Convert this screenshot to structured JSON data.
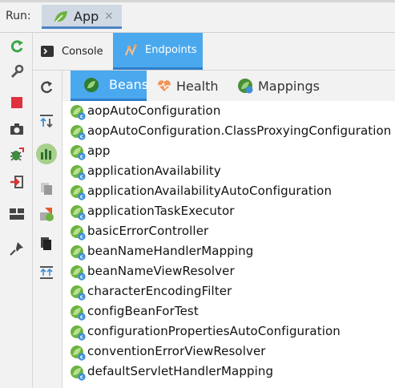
{
  "run": {
    "label": "Run:",
    "tab_label": "App",
    "tab_close": "×"
  },
  "toolbar": {
    "left_icons": [
      "rerun-icon",
      "wrench-icon",
      "stop-icon",
      "camera-icon",
      "debug-bug-icon",
      "exit-icon",
      "layout-icon",
      "pin-icon"
    ]
  },
  "subtabs": [
    {
      "label": "Console",
      "icon": "console-icon",
      "selected": false
    },
    {
      "label": "Endpoints",
      "icon": "endpoints-icon",
      "selected": true
    }
  ],
  "side_icons": [
    "refresh-icon",
    "sort-icon",
    "chart-icon",
    "copy-files-icon",
    "beans-graph-icon",
    "pages-icon",
    "expand-icon"
  ],
  "bean_tabs": [
    {
      "label": "Beans",
      "selected": true
    },
    {
      "label": "Health",
      "selected": false
    },
    {
      "label": "Mappings",
      "selected": false
    }
  ],
  "beans": [
    "aopAutoConfiguration",
    "aopAutoConfiguration.ClassProxyingConfiguration",
    "app",
    "applicationAvailability",
    "applicationAvailabilityAutoConfiguration",
    "applicationTaskExecutor",
    "basicErrorController",
    "beanNameHandlerMapping",
    "beanNameViewResolver",
    "characterEncodingFilter",
    "configBeanForTest",
    "configurationPropertiesAutoConfiguration",
    "conventionErrorViewResolver",
    "defaultServletHandlerMapping"
  ],
  "colors": {
    "accent": "#4aa8ee",
    "spring_green": "#6db33f",
    "bean_badge": "#3d8fd6"
  }
}
